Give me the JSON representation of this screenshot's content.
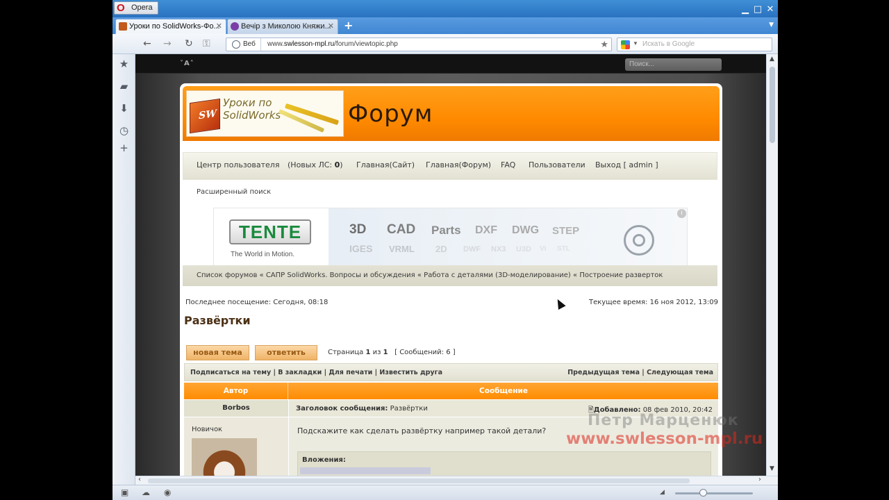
{
  "window": {
    "app_button": "Opera",
    "controls": [
      "minimize",
      "maximize",
      "close"
    ]
  },
  "tabs": [
    {
      "label": "Уроки по SolidWorks-Фо...",
      "icon_color": "#c25a1c",
      "active": true
    },
    {
      "label": "Вечір з Миколою Княжи...",
      "icon_color": "#7a3fa6",
      "active": false
    }
  ],
  "addressbar": {
    "web_label": "Веб",
    "url_prefix": "www.",
    "url_domain": "swlesson-mpl.ru",
    "url_path": "/forum/viewtopic.php",
    "search_placeholder": "Искать в Google"
  },
  "site_top": {
    "font_size_control": "˅A˄",
    "search_placeholder": "Поиск..."
  },
  "header": {
    "logo_text_line1": "Уроки по",
    "logo_text_line2": "SolidWorks",
    "logo_cube_text": "SW",
    "title": "Форум"
  },
  "nav": {
    "user_center": "Центр пользователя",
    "new_pm_label": "(Новых ЛС: ",
    "new_pm_count": "0",
    "new_pm_close": ")",
    "main_site": "Главная(Сайт)",
    "main_forum": "Главная(Форум)",
    "faq": "FAQ",
    "users": "Пользователи",
    "logout": "Выход [ admin ]",
    "advanced_search": "Расширенный поиск"
  },
  "ad": {
    "logo": "TENTE",
    "slogan": "The World in Motion.",
    "formats_row1": [
      "3D",
      "CAD",
      "Parts",
      "DXF",
      "DWG",
      "STEP"
    ],
    "formats_row2": [
      "IGES",
      "VRML",
      "2D",
      "DWF",
      "NX3",
      "U3D",
      "VI",
      "STL"
    ],
    "info": "i"
  },
  "breadcrumb": "Список форумов « САПР SolidWorks. Вопросы и обсуждения « Работа с деталями (3D-моделирование) « Построение разверток",
  "visit": {
    "last_visit": "Последнее посещение: Сегодня, 08:18",
    "current_time": "Текущее время: 16 ноя 2012, 13:09"
  },
  "topic": {
    "title": "Развёртки",
    "new_topic_button": "новая тема",
    "reply_button": "ответить",
    "page_label": "Страница ",
    "page_current": "1",
    "page_of": " из ",
    "page_total": "1",
    "messages": "[ Сообщений: 6 ]"
  },
  "topic_tools": {
    "left": "Подписаться на тему | В закладки | Для печати | Известить друга",
    "right": "Предыдущая тема | Следующая тема"
  },
  "post_table": {
    "author_header": "Автор",
    "message_header": "Сообщение"
  },
  "post": {
    "author": "Borbos",
    "subject_label": "Заголовок сообщения:",
    "subject": " Развёртки",
    "added_label": "Добавлено:",
    "added_value": " 08 фев 2010, 20:42",
    "rank": "Новичок",
    "text": "Подскажите как сделать развёртку например такой детали?",
    "attachments_label": "Вложения:"
  },
  "watermark": {
    "line1": "Петр Марценюк",
    "line2": "www.swlesson-mpl.ru"
  },
  "colors": {
    "accent": "#ff8c00",
    "tab_bar": "#3f86d2"
  }
}
